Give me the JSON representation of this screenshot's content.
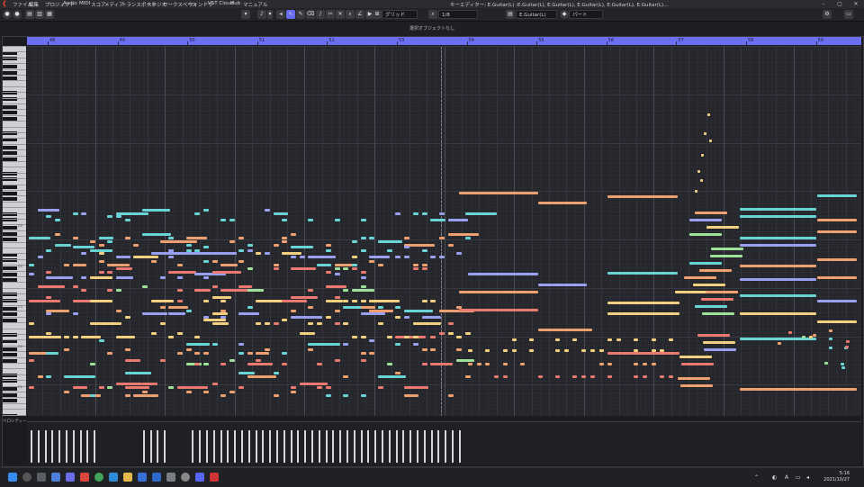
{
  "app": {
    "menus": [
      "ファイル",
      "編集",
      "プロジェクト",
      "Audio",
      "MIDI",
      "スコア",
      "メディア",
      "トランスポート",
      "スタジオ",
      "ワークスペース",
      "ウィンドウ",
      "VST Cloud",
      "Hub",
      "マニュアル"
    ],
    "window_title": "キーエディター: E.Guitar(L) :E.Guitar(L), E.Guitar(L), E.Guitar(L), E.Guitar(L), E.Guitar(L)...",
    "window_buttons": [
      "–",
      "▢",
      "✕"
    ]
  },
  "toolbar": {
    "snap_type": "グリッド",
    "quantize": "1/8",
    "track": "E.Guitar(L)",
    "part_mode": "パート"
  },
  "info_line": "選択オブジェクトなし",
  "ruler": {
    "bars": [
      "48",
      "49",
      "50",
      "51",
      "52",
      "53",
      "54",
      "55",
      "56",
      "57",
      "58",
      "59"
    ]
  },
  "keyboard": {
    "c_labels": [
      "C5",
      "C4",
      "C3",
      "C2",
      "C1",
      "C0",
      "C-1"
    ]
  },
  "velocity": {
    "label": "ベロシティー"
  },
  "taskbar": {
    "time": "5:16",
    "date": "2021/10/27",
    "ime": "A"
  },
  "colors": {
    "ruler": "#6d6ff2",
    "note_orange": "#f0a070",
    "note_cyan": "#6ad3d6",
    "note_lavender": "#9aa0f0",
    "note_yellow": "#f2d080",
    "note_red": "#ea7a70",
    "note_green": "#9ee29a"
  }
}
